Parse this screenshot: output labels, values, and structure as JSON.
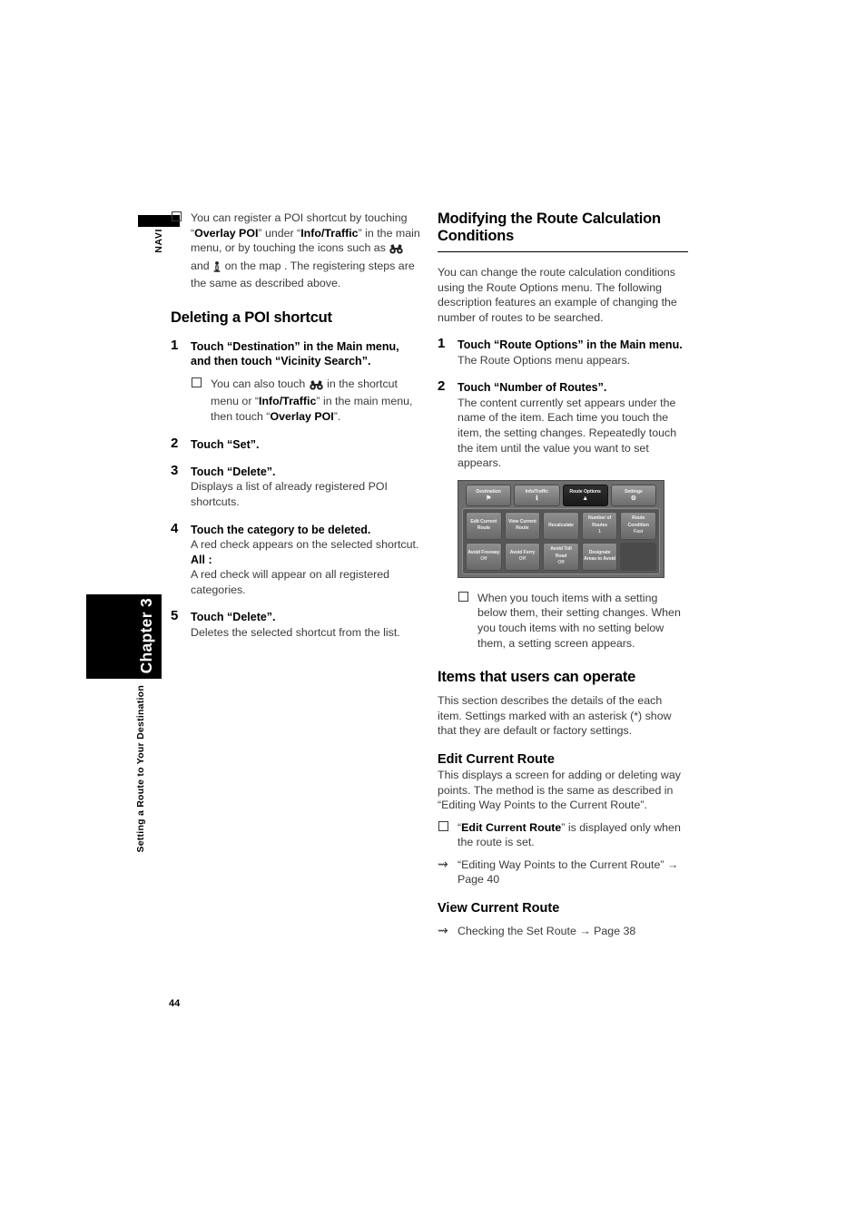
{
  "page": {
    "number": "44",
    "navi_label": "NAVI",
    "chapter_label": "Chapter 3",
    "chapter_subtitle": "Setting a Route to Your Destination"
  },
  "left_column": {
    "intro_note": {
      "segments": [
        "You can register a POI shortcut by touching “",
        "Overlay POI",
        "” under “",
        "Info/Traffic",
        "” in the main menu, or by touching the icons such as ",
        "binoculars-icon",
        " and ",
        "info-person-icon",
        " on the map . The registering steps are the same as described above."
      ],
      "plain": "You can register a POI shortcut by touching “Overlay POI” under “Info/Traffic” in the main menu, or by touching the icons such as and on the map . The registering steps are the same as described above."
    },
    "heading": "Deleting a POI shortcut",
    "steps": [
      {
        "num": "1",
        "head": "Touch “Destination” in the Main menu, and then touch “Vicinity Search”.",
        "desc": "",
        "note_plain": "You can also touch in the shortcut menu or “Info/Traffic” in the main menu, then touch “Overlay POI”."
      },
      {
        "num": "2",
        "head": "Touch “Set”.",
        "desc": ""
      },
      {
        "num": "3",
        "head": "Touch “Delete”.",
        "desc": "Displays a list of already registered POI shortcuts."
      },
      {
        "num": "4",
        "head": "Touch the category to be deleted.",
        "desc": "A red check appears on the selected shortcut.",
        "sub_label": "All :",
        "sub_desc": "A red check will appear on all registered categories."
      },
      {
        "num": "5",
        "head": "Touch “Delete”.",
        "desc": "Deletes the selected shortcut from the list."
      }
    ]
  },
  "right_column": {
    "heading": "Modifying the Route Calculation Conditions",
    "intro": "You can change the route calculation conditions using the Route Options menu. The following description features an example of changing the number of routes to be searched.",
    "steps": [
      {
        "num": "1",
        "head": "Touch “Route Options” in the Main menu.",
        "desc": "The Route Options menu appears."
      },
      {
        "num": "2",
        "head": "Touch “Number of Routes”.",
        "desc": "The content currently set appears under the name of the item. Each time you touch the item, the setting changes. Repeatedly touch the item until the value you want to set appears."
      }
    ],
    "figure_note": "When you touch items with a setting below them, their setting changes. When you touch items with no setting below them, a setting screen appears.",
    "items_heading": "Items that users can operate",
    "items_intro": "This section describes the details of the each item. Settings marked with an asterisk (*) show that they are default or factory settings.",
    "subsections": [
      {
        "title": "Edit Current Route",
        "body": "This displays a screen for adding or deleting way points. The method is the same as described in “Editing Way Points to the Current Route”.",
        "note_plain": "“Edit Current Route” is displayed only when the route is set.",
        "note_bold": "Edit Current Route",
        "xref": "“Editing Way Points to the Current Route” → Page 40"
      },
      {
        "title": "View Current Route",
        "xref": "Checking the Set Route → Page 38"
      }
    ]
  },
  "device_screenshot": {
    "tabs": [
      {
        "label": "Destination",
        "icon": "flag-icon",
        "active": false
      },
      {
        "label": "Info/Traffic",
        "icon": "info-icon",
        "active": false
      },
      {
        "label": "Route Options",
        "icon": "route-icon",
        "active": true
      },
      {
        "label": "Settings",
        "icon": "gear-icon",
        "active": false
      }
    ],
    "grid": [
      [
        {
          "label": "Edit Current Route",
          "value": ""
        },
        {
          "label": "View Current Route",
          "value": ""
        },
        {
          "label": "Recalculate",
          "value": ""
        },
        {
          "label": "Number of Routes",
          "value": "1"
        },
        {
          "label": "Route Condition",
          "value": "Fast"
        }
      ],
      [
        {
          "label": "Avoid Freeway",
          "value": "Off"
        },
        {
          "label": "Avoid Ferry",
          "value": "Off"
        },
        {
          "label": "Avoid Toll Road",
          "value": "Off"
        },
        {
          "label": "Designate Areas to Avoid",
          "value": ""
        },
        {
          "label": "",
          "value": "",
          "empty": true
        }
      ]
    ]
  }
}
